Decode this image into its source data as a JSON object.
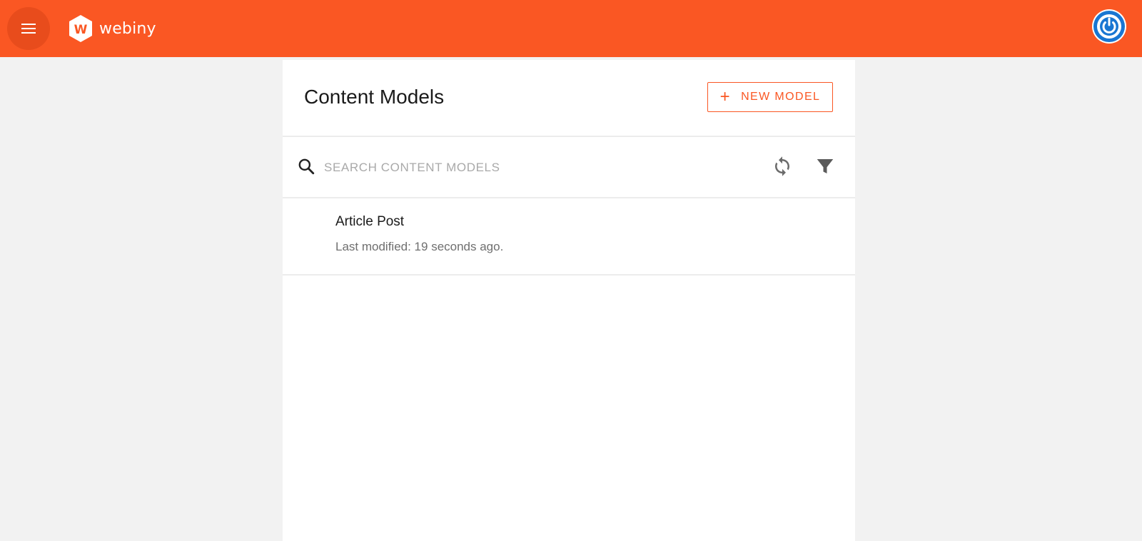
{
  "colors": {
    "brand": "#fa5723",
    "menu_circle": "#e84c1c",
    "avatar_ring": "#1976d2"
  },
  "header": {
    "menu_icon": "hamburger-menu-icon",
    "logo_text": "webiny",
    "avatar_icon": "power-icon"
  },
  "page": {
    "title": "Content Models",
    "new_button_label": "NEW MODEL"
  },
  "search": {
    "placeholder": "SEARCH CONTENT MODELS",
    "value": "",
    "refresh_icon": "refresh-icon",
    "filter_icon": "filter-icon"
  },
  "list": {
    "items": [
      {
        "title": "Article Post",
        "subtitle": "Last modified: 19 seconds ago."
      }
    ]
  }
}
